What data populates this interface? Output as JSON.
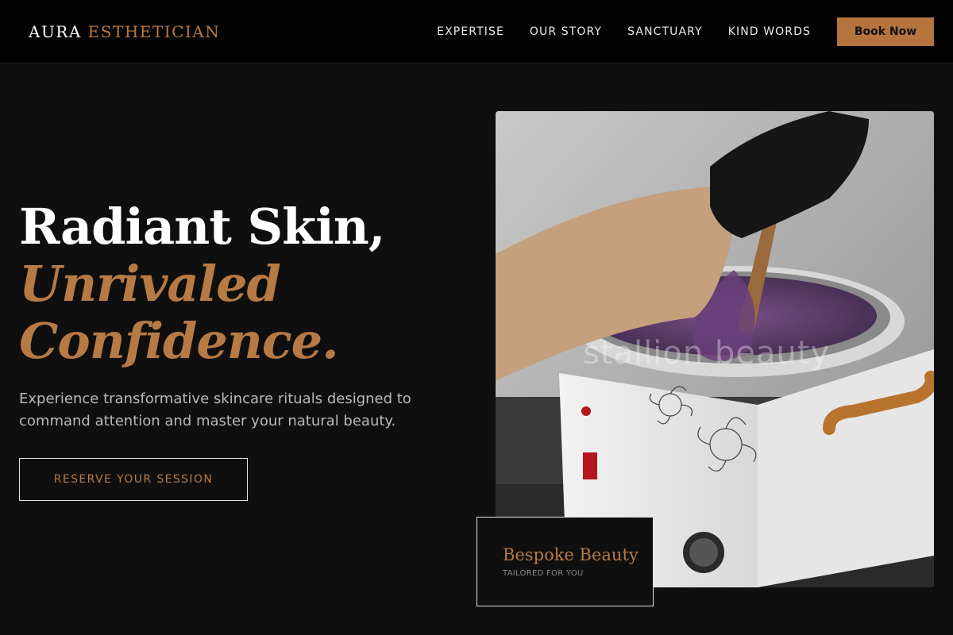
{
  "header": {
    "logo_primary": "AURA",
    "logo_accent": "ESTHETICIAN",
    "nav": [
      "EXPERTISE",
      "OUR STORY",
      "SANCTUARY",
      "KIND WORDS"
    ],
    "book_label": "Book Now"
  },
  "hero": {
    "title_line1": "Radiant Skin,",
    "title_line2": "Unrivaled",
    "title_line3": "Confidence.",
    "subtitle": "Experience transformative skincare rituals designed to command attention and master your natural beauty.",
    "cta_label": "RESERVE YOUR SESSION",
    "image_watermark": "stallion beauty"
  },
  "card": {
    "title": "Bespoke Beauty",
    "subtitle": "TAILORED FOR YOU"
  },
  "colors": {
    "accent": "#b87a45",
    "background": "#0f0f0f",
    "header_bg": "#030303"
  }
}
